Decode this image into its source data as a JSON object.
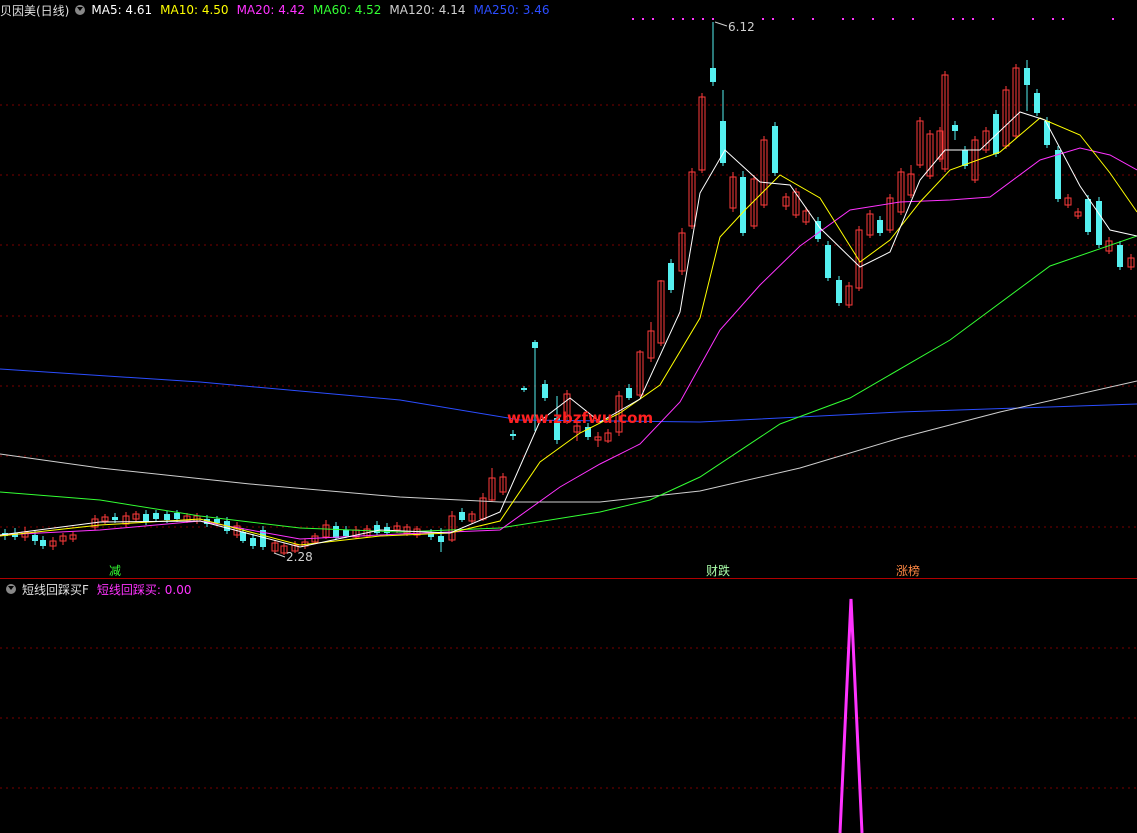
{
  "price_legend": {
    "title": "贝因美(日线)",
    "items": [
      {
        "label": "MA5: 4.61",
        "color": "#ffffff"
      },
      {
        "label": "MA10: 4.50",
        "color": "#ffff00"
      },
      {
        "label": "MA20: 4.42",
        "color": "#ff33ff"
      },
      {
        "label": "MA60: 4.52",
        "color": "#33ff33"
      },
      {
        "label": "MA120: 4.14",
        "color": "#cfcfcf"
      },
      {
        "label": "MA250: 3.46",
        "color": "#2b4dff"
      }
    ]
  },
  "indicator_legend": {
    "title": "短线回踩买F",
    "value_label": "短线回踩买: 0.00",
    "value_color": "#ff33ff"
  },
  "annotations": {
    "high": "6.12",
    "low": "2.28"
  },
  "signals": [
    {
      "label": "减",
      "color": "#33ff33"
    },
    {
      "label": "财跌",
      "color": "#aaffaa"
    },
    {
      "label": "涨榜",
      "color": "#ff8844"
    }
  ],
  "watermark": "www.zbzfwu.com",
  "colors": {
    "up": "#ff3b3b",
    "down": "#55f0f0",
    "grid": "#7a0000"
  }
}
